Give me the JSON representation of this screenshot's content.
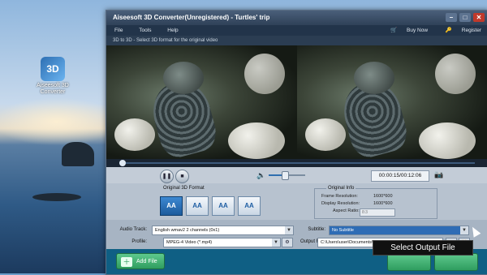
{
  "desktop": {
    "icon": {
      "glyph": "3D",
      "label": "Aiseesoft 3D Converter"
    }
  },
  "window": {
    "title": "Aiseesoft 3D Converter(Unregistered) - Turtles' trip",
    "controls": {
      "minimize": "–",
      "maximize": "□",
      "close": "✕"
    }
  },
  "menu": {
    "items": [
      "File",
      "Tools",
      "Help"
    ],
    "buy_now": "Buy Now",
    "register": "Register"
  },
  "hint": "3D to 3D - Select 3D format for the original video",
  "playback": {
    "progress": 0.01,
    "time": "00:00:15/00:12:06",
    "volume": 0.45,
    "pause_icon": "pause-icon",
    "stop_icon": "stop-icon",
    "snapshot_icon": "camera-icon"
  },
  "format": {
    "label": "Original 3D Format",
    "options": [
      "AA",
      "AA",
      "AA",
      "AA"
    ],
    "selected_index": 0
  },
  "original_info": {
    "label": "Original Info",
    "frame_resolution_label": "Frame Resolution:",
    "frame_resolution": "1600*600",
    "display_resolution_label": "Display Resolution:",
    "display_resolution": "1600*600",
    "aspect_ratio_label": "Aspect Ratio:",
    "aspect_ratio": "8:3"
  },
  "settings": {
    "audio_track_label": "Audio Track:",
    "audio_track": "English wmav2 2 channels (0x1)",
    "subtitle_label": "Subtitle:",
    "subtitle": "No Subtitle",
    "profile_label": "Profile:",
    "profile": "MPEG-4 Video (*.mp4)",
    "output_file_label": "Output File:",
    "output_file": "C:\\Users\\user\\Documents\\Aiseesoft Studio\\Video",
    "browse": "..."
  },
  "bottom": {
    "add_file": "Add File"
  },
  "tooltip": "Select Output File",
  "colors": {
    "accent": "#2e6cb5",
    "bottom_bar": "#0f5f84",
    "green_button": "#2f9d5f"
  }
}
